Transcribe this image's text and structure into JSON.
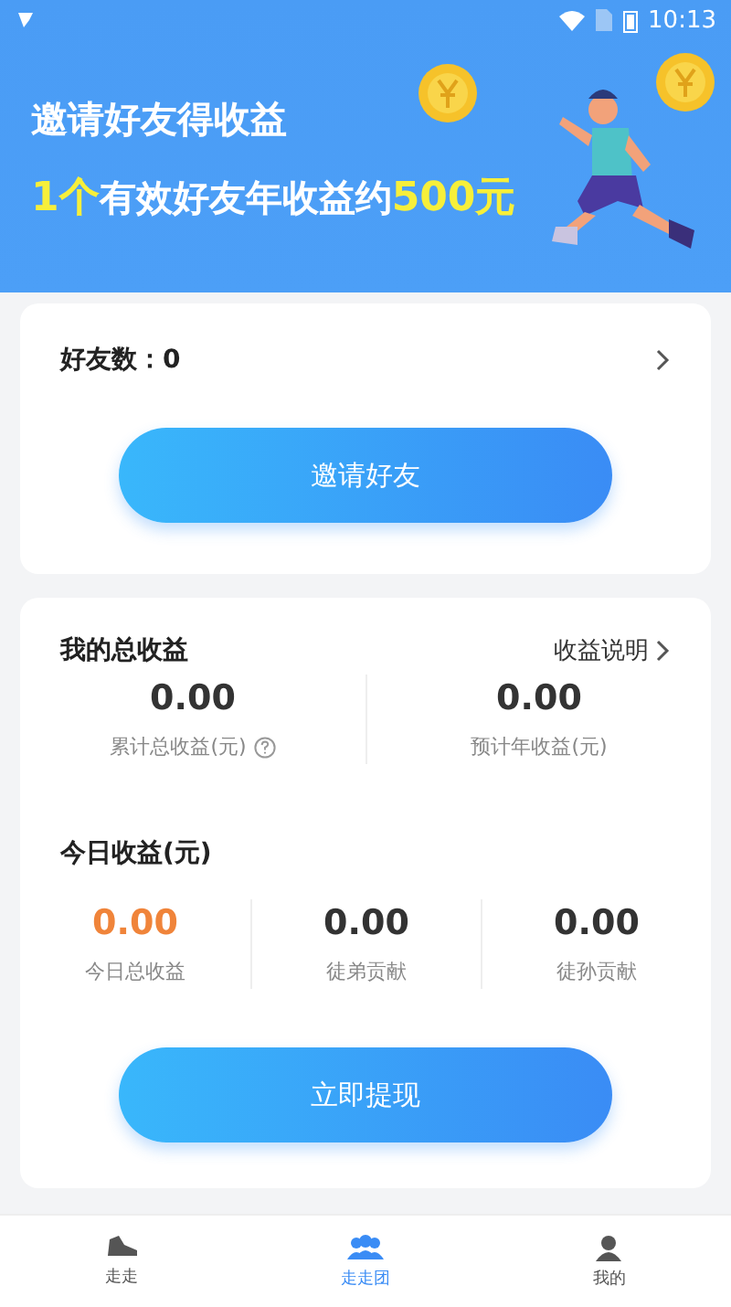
{
  "status_bar": {
    "time": "10:13"
  },
  "banner": {
    "title": "邀请好友得收益",
    "subtitle": [
      {
        "text": "1个",
        "highlight": true
      },
      {
        "text": "有效好友年收益约",
        "highlight": false
      },
      {
        "text": "500元",
        "highlight": true
      }
    ]
  },
  "friends_card": {
    "label": "好友数：0",
    "button": "邀请好友"
  },
  "earnings_card": {
    "title": "我的总收益",
    "link": "收益说明",
    "totals": [
      {
        "value": "0.00",
        "label": "累计总收益(元)",
        "help": true
      },
      {
        "value": "0.00",
        "label": "预计年收益(元)",
        "help": false
      }
    ],
    "today_title": "今日收益(元)",
    "today": [
      {
        "value": "0.00",
        "label": "今日总收益",
        "highlight": true
      },
      {
        "value": "0.00",
        "label": "徒弟贡献",
        "highlight": false
      },
      {
        "value": "0.00",
        "label": "徒孙贡献",
        "highlight": false
      }
    ],
    "button": "立即提现"
  },
  "tabs": [
    {
      "label": "走走",
      "kind": "shoe",
      "selected": false
    },
    {
      "label": "走走团",
      "kind": "group",
      "selected": true
    },
    {
      "label": "我的",
      "kind": "person",
      "selected": false
    }
  ]
}
